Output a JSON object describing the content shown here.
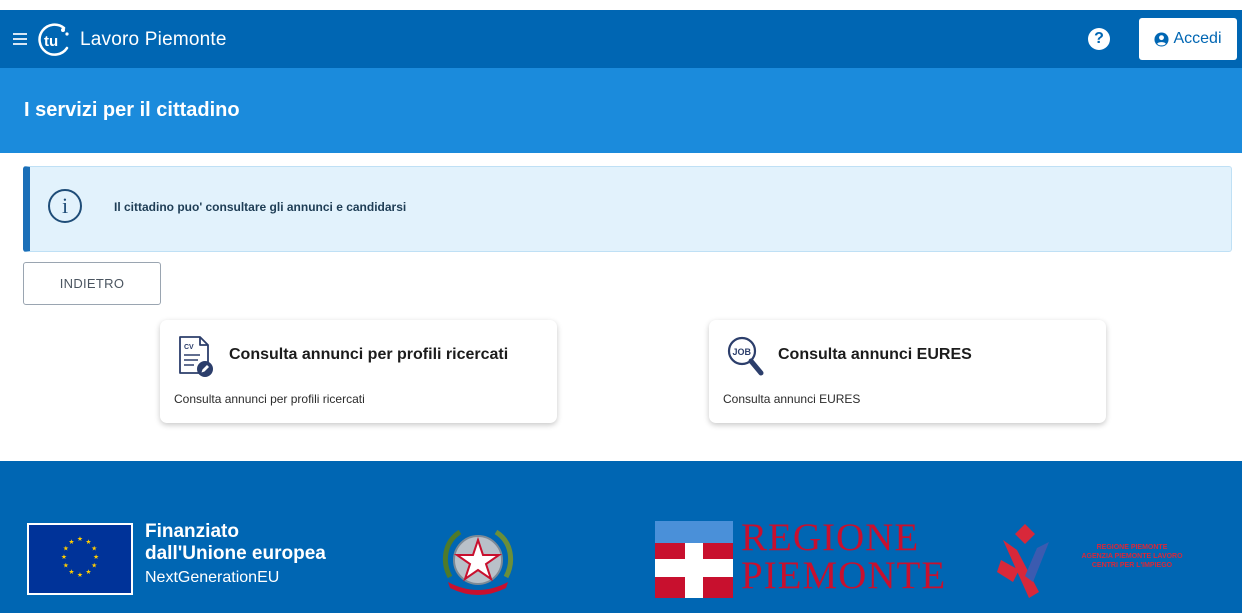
{
  "header": {
    "app_title": "Lavoro Piemonte",
    "logo_text": "tu",
    "help_label": "?",
    "login_label": "Accedi",
    "icons": {
      "menu": "hamburger-icon",
      "help": "question-circle-icon",
      "login": "user-circle-icon"
    }
  },
  "section": {
    "title": "I servizi per il cittadino"
  },
  "alert": {
    "icon": "info-circle-icon",
    "text": "Il cittadino puo' consultare gli annunci e candidarsi"
  },
  "back_button": {
    "label": "INDIETRO"
  },
  "cards": [
    {
      "title": "Consulta annunci per profili ricercati",
      "description": "Consulta annunci per profili ricercati",
      "icon": "cv-document-icon"
    },
    {
      "title": "Consulta annunci EURES",
      "description": "Consulta annunci EURES",
      "icon": "job-search-icon"
    }
  ],
  "footer": {
    "eu_line1": "Finanziato",
    "eu_line2": "dall'Unione europea",
    "eu_line3": "NextGenerationEU",
    "regione_line1": "REGIONE",
    "regione_line2": "PIEMONTE",
    "agency_line1": "REGIONE PIEMONTE",
    "agency_line2": "AGENZIA PIEMONTE LAVORO",
    "agency_line3": "CENTRI PER L'IMPIEGO"
  },
  "colors": {
    "header_bg": "#0066b3",
    "section_bg": "#1b8bdc",
    "alert_bg": "#e2f2fc",
    "alert_border": "#1b6fb8",
    "footer_bg": "#0066b3",
    "regione_red": "#c8102e"
  }
}
